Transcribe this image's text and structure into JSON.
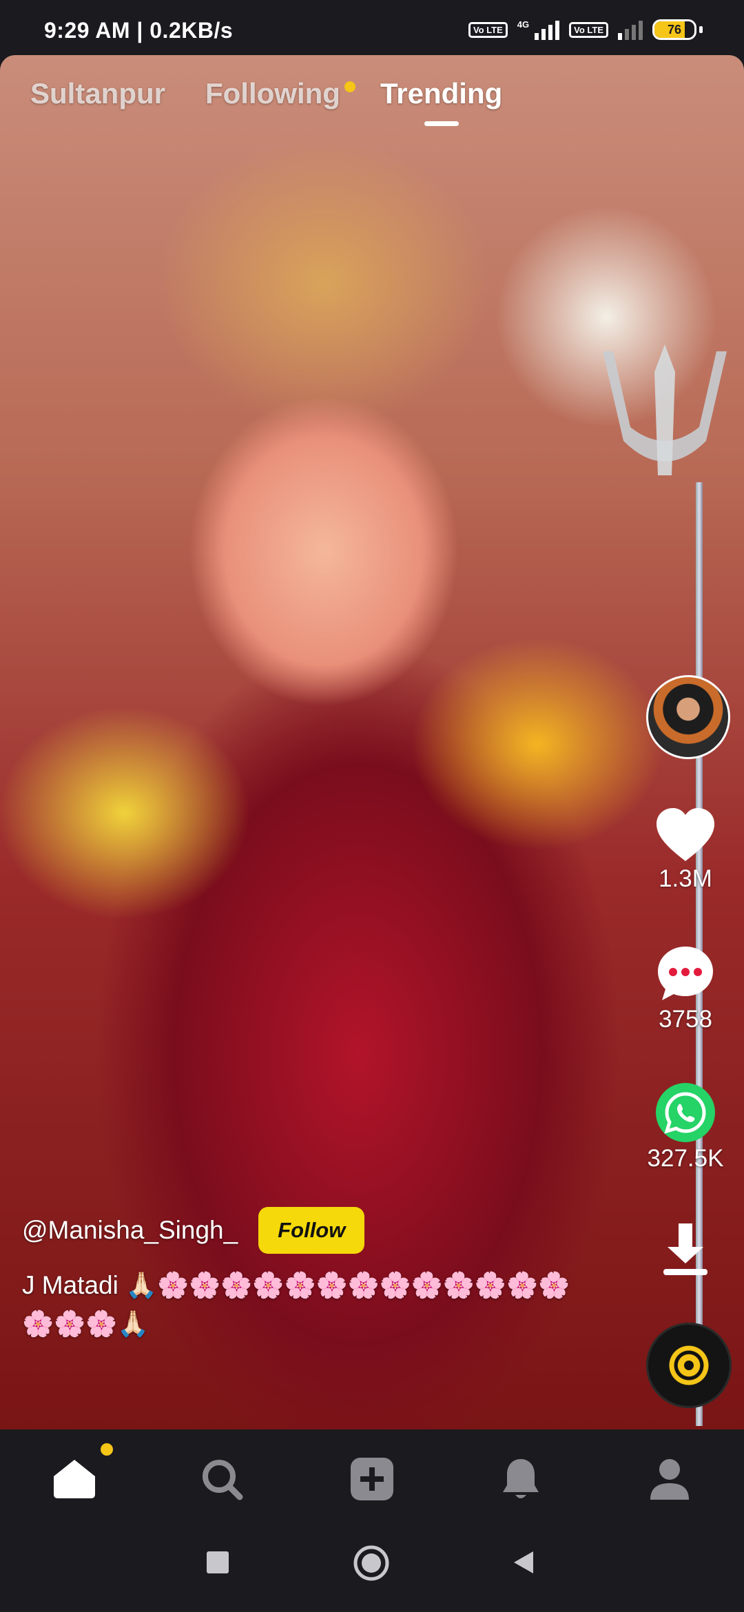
{
  "status_bar": {
    "time": "9:29 AM | 0.2KB/s",
    "volte_label_1": "Vo LTE",
    "network": "4G",
    "volte_label_2": "Vo LTE",
    "battery": "76",
    "battery_fraction": 0.76
  },
  "tabs": [
    {
      "label": "Sultanpur",
      "active": false
    },
    {
      "label": "Following",
      "active": false,
      "has_dot": true
    },
    {
      "label": "Trending",
      "active": true
    }
  ],
  "actions": {
    "likes": "1.3M",
    "comments": "3758",
    "shares": "327.5K"
  },
  "post": {
    "username": "@Manisha_Singh_",
    "follow_label": "Follow",
    "caption": "J Matadi 🙏🏻🌸🌸🌸🌸🌸🌸🌸🌸🌸🌸🌸🌸🌸🌸🌸🌸🙏🏻"
  },
  "bottom_nav": [
    {
      "icon": "home-icon",
      "active": true,
      "badge": true
    },
    {
      "icon": "search-icon"
    },
    {
      "icon": "add-icon"
    },
    {
      "icon": "bell-icon"
    },
    {
      "icon": "profile-icon"
    }
  ],
  "colors": {
    "accent": "#f5c518",
    "follow_bg": "#f5d90a",
    "share_green": "#25d366",
    "bar_bg": "#1a1a1f"
  }
}
